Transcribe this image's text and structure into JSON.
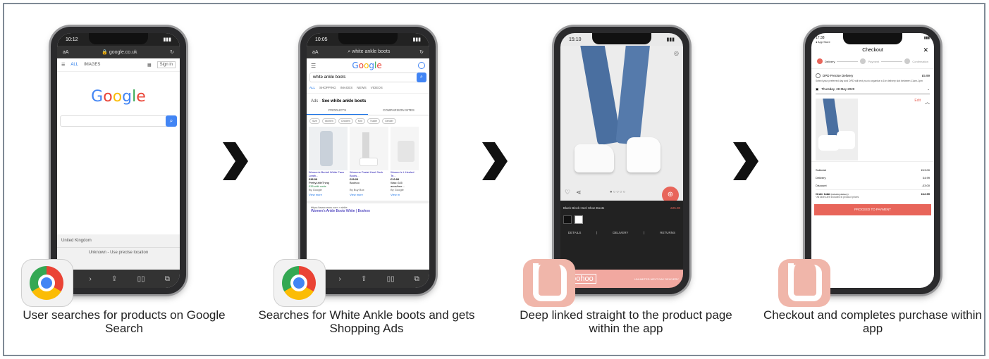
{
  "steps": [
    {
      "caption": "User searches for products on Google Search",
      "status_time": "10:12",
      "url": "google.co.uk",
      "aa": "aA",
      "tabs": [
        "ALL",
        "IMAGES"
      ],
      "sign_in": "Sign in",
      "logo": "Google",
      "region": "United Kingdom",
      "location": "Unknown - Use precise location"
    },
    {
      "caption": "Searches for White Ankle boots and gets Shopping Ads",
      "status_time": "10:05",
      "url": "white ankle boots",
      "aa": "aA",
      "logo": "Google",
      "query": "white ankle boots",
      "tabs": [
        "ALL",
        "SHOPPING",
        "IMAGES",
        "NEWS",
        "VIDEOS"
      ],
      "ads_heading": "See white ankle boots",
      "ads_label": "Ads ·",
      "subtabs": [
        "PRODUCTS",
        "COMPARISON SITES"
      ],
      "filters": [
        "Size",
        "Women",
        "Children",
        "Knit",
        "Trader",
        "Gender"
      ],
      "products": [
        {
          "title": "Women's Bertoli White Faux Leath...",
          "price": "£36.00",
          "store": "PrettyLittleThing",
          "extra": "£35 with code",
          "by": "By Google",
          "more": "View more"
        },
        {
          "title": "Womens Pastel Heel Sock Boots...",
          "price": "£29.20",
          "store": "Boohoo",
          "extra": "",
          "by": "By Buy Box",
          "more": "View more"
        },
        {
          "title": "Women's L Heeled Te...",
          "price": "£10.00",
          "store": "Was: £45",
          "extra": "asos/free...",
          "by": "By Google",
          "more": "View m"
        }
      ],
      "result_url": "https://www.asos.com › white",
      "result_title": "Women's Ankle Boots White | Boohoo"
    },
    {
      "caption": "Deep linked straight to the product page within the app",
      "status_time": "15:10",
      "product_name": "Black Block Heel Shoe Boots",
      "price": "£25.00",
      "tabs": [
        "DETAILS",
        "DELIVERY",
        "RETURNS"
      ],
      "brand": "boohoo",
      "banner": "UNLIMITED NEXT DAY DELIVERY"
    },
    {
      "caption": "Checkout and completes purchase within app",
      "status_time": "17:38",
      "store_back": "◂ App Store",
      "title": "Checkout",
      "close": "✕",
      "steps": [
        "Delivery",
        "Payment",
        "Confirmation"
      ],
      "delivery_option": "DPD Precise Delivery",
      "delivery_price": "£5.99",
      "delivery_desc": "Select your preferred day and DPD will text you to organise a 1hr delivery slot between 11am-1pm",
      "date": "Thursday, 28 May 2020",
      "edit": "Edit",
      "summary": [
        {
          "label": "Subtotal",
          "value": "£13.00"
        },
        {
          "label": "Delivery",
          "value": "£4.99"
        },
        {
          "label": "Discount",
          "value": "-£3.00"
        }
      ],
      "order_total_label": "Order total",
      "order_total_note": "(including delivery)",
      "order_total_value": "£12.99",
      "vat_note": "*All taxes are included in product prices",
      "cta": "PROCEED TO PAYMENT"
    }
  ],
  "colors": {
    "frame": "#7f8a95",
    "google_blue": "#4285f4",
    "boohoo_pink": "#f0b6aa",
    "cta_red": "#e8655a"
  }
}
